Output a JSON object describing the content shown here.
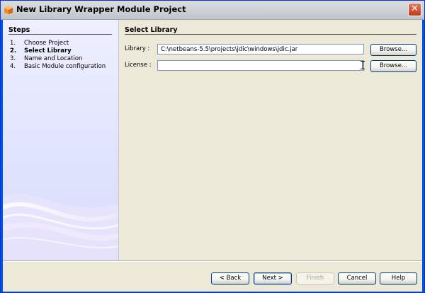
{
  "window": {
    "title": "New Library Wrapper Module Project",
    "close_glyph": "✕"
  },
  "steps": {
    "heading": "Steps",
    "items": [
      {
        "num": "1.",
        "label": "Choose Project",
        "current": false
      },
      {
        "num": "2.",
        "label": "Select Library",
        "current": true
      },
      {
        "num": "3.",
        "label": "Name and Location",
        "current": false
      },
      {
        "num": "4.",
        "label": "Basic Module configuration",
        "current": false
      }
    ]
  },
  "main": {
    "heading": "Select Library",
    "library": {
      "label": "Library :",
      "value": "C:\\netbeans-5.5\\projects\\jdic\\windows\\jdic.jar",
      "browse_label": "Browse..."
    },
    "license": {
      "label": "License :",
      "value": "",
      "browse_label": "Browse..."
    }
  },
  "footer": {
    "back_label": "< Back",
    "next_label": "Next >",
    "finish_label": "Finish",
    "cancel_label": "Cancel",
    "help_label": "Help"
  },
  "colors": {
    "titlebar": "#cfd3d8",
    "close_button": "#c4391a",
    "steps_panel": "#dfe3fd",
    "dialog_body": "#ece9d8",
    "button_border": "#003c74"
  },
  "icons": {
    "title": "netbeans-cube-icon",
    "close": "close-icon",
    "cursor": "text-cursor-icon"
  }
}
